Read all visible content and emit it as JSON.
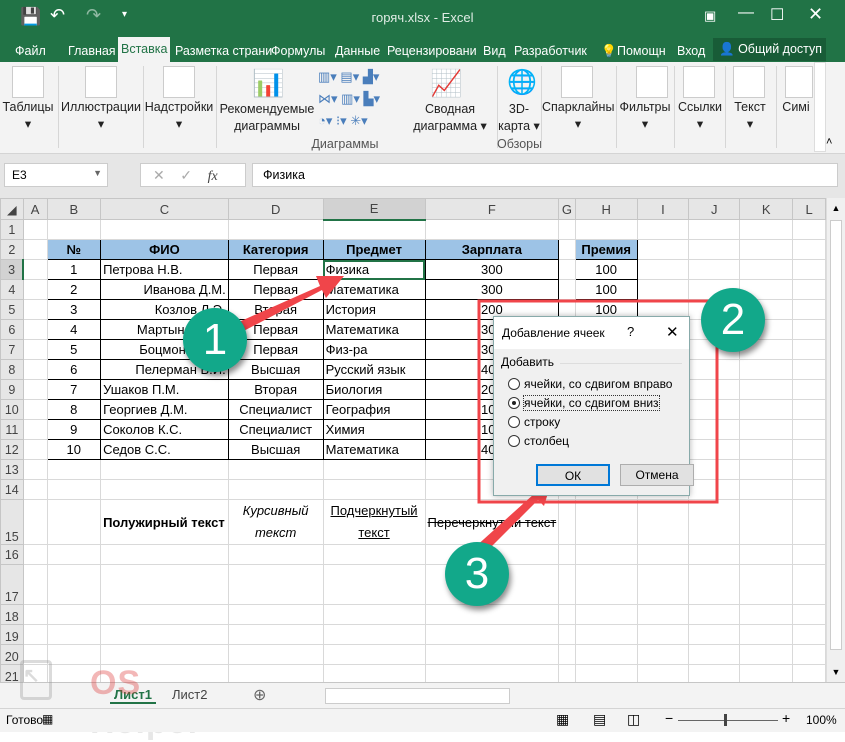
{
  "window": {
    "title": "горяч.xlsx - Excel"
  },
  "menu_tabs": [
    "Файл",
    "Главная",
    "Вставка",
    "Разметка страни",
    "Формулы",
    "Данные",
    "Рецензировани",
    "Вид",
    "Разработчик",
    "Помощн",
    "Вход"
  ],
  "active_tab": "Вставка",
  "share_label": "Общий доступ",
  "ribbon": {
    "tables": "Таблицы",
    "illustrations": "Иллюстрации",
    "addins": "Надстройки",
    "recommended_charts": [
      "Рекомендуемые",
      "диаграммы"
    ],
    "pivot_chart": [
      "Сводная",
      "диаграмма"
    ],
    "map3d": [
      "3D-",
      "карта"
    ],
    "sparklines": "Спарклайны",
    "filters": "Фильтры",
    "links": "Ссылки",
    "text": "Текст",
    "symbols": "Симі",
    "group_charts": "Диаграммы",
    "group_tours": "Обзоры"
  },
  "formula_bar": {
    "name_box": "E3",
    "fx": "fx",
    "value": "Физика"
  },
  "columns": [
    "A",
    "B",
    "C",
    "D",
    "E",
    "F",
    "G",
    "H",
    "I",
    "J",
    "K",
    "L"
  ],
  "selected_cell": "E3",
  "table": {
    "headers": [
      "№",
      "ФИО",
      "Категория",
      "Предмет",
      "Зарплата",
      "Премия"
    ],
    "rows": [
      [
        "1",
        "Петрова Н.В.",
        "Первая",
        "Физика",
        "300",
        "100"
      ],
      [
        "2",
        "Иванова Д.М.",
        "Первая",
        "Математика",
        "300",
        "100"
      ],
      [
        "3",
        "Козлов Л.Э.",
        "Вторая",
        "История",
        "200",
        "100"
      ],
      [
        "4",
        "Мартынов К.А.",
        "Первая",
        "Математика",
        "300",
        ""
      ],
      [
        "5",
        "Боцмонов Д.Р.",
        "Первая",
        "Физ-ра",
        "300",
        ""
      ],
      [
        "6",
        "Пелерман В.И.",
        "Высшая",
        "Русский язык",
        "400",
        ""
      ],
      [
        "7",
        "Ушаков П.М.",
        "Вторая",
        "Биология",
        "200",
        ""
      ],
      [
        "8",
        "Георгиев Д.М.",
        "Специалист",
        "География",
        "100",
        ""
      ],
      [
        "9",
        "Соколов К.С.",
        "Специалист",
        "Химия",
        "100",
        ""
      ],
      [
        "10",
        "Седов С.С.",
        "Высшая",
        "Математика",
        "400",
        ""
      ]
    ]
  },
  "row15": {
    "bold": "Полужирный текст",
    "italic": [
      "Курсивный",
      "текст"
    ],
    "underline": [
      "Подчеркнутый",
      "текст"
    ],
    "strike": "Перечеркнутый текст"
  },
  "sheets": [
    "Лист1",
    "Лист2"
  ],
  "status": {
    "ready": "Готово",
    "zoom": "100%"
  },
  "dialog": {
    "title": "Добавление ячеек",
    "help": "?",
    "group": "Добавить",
    "options": [
      "ячейки, со сдвигом вправо",
      "ячейки, со сдвигом вниз",
      "строку",
      "столбец"
    ],
    "selected_option": 1,
    "ok": "ОК",
    "cancel": "Отмена"
  },
  "badges": [
    "1",
    "2",
    "3"
  ],
  "watermark": "OS Helper",
  "colors": {
    "excel_green": "#217346",
    "header_fill": "#9dc3e6",
    "badge": "#12a88a",
    "annotation_red": "#f0454a"
  }
}
